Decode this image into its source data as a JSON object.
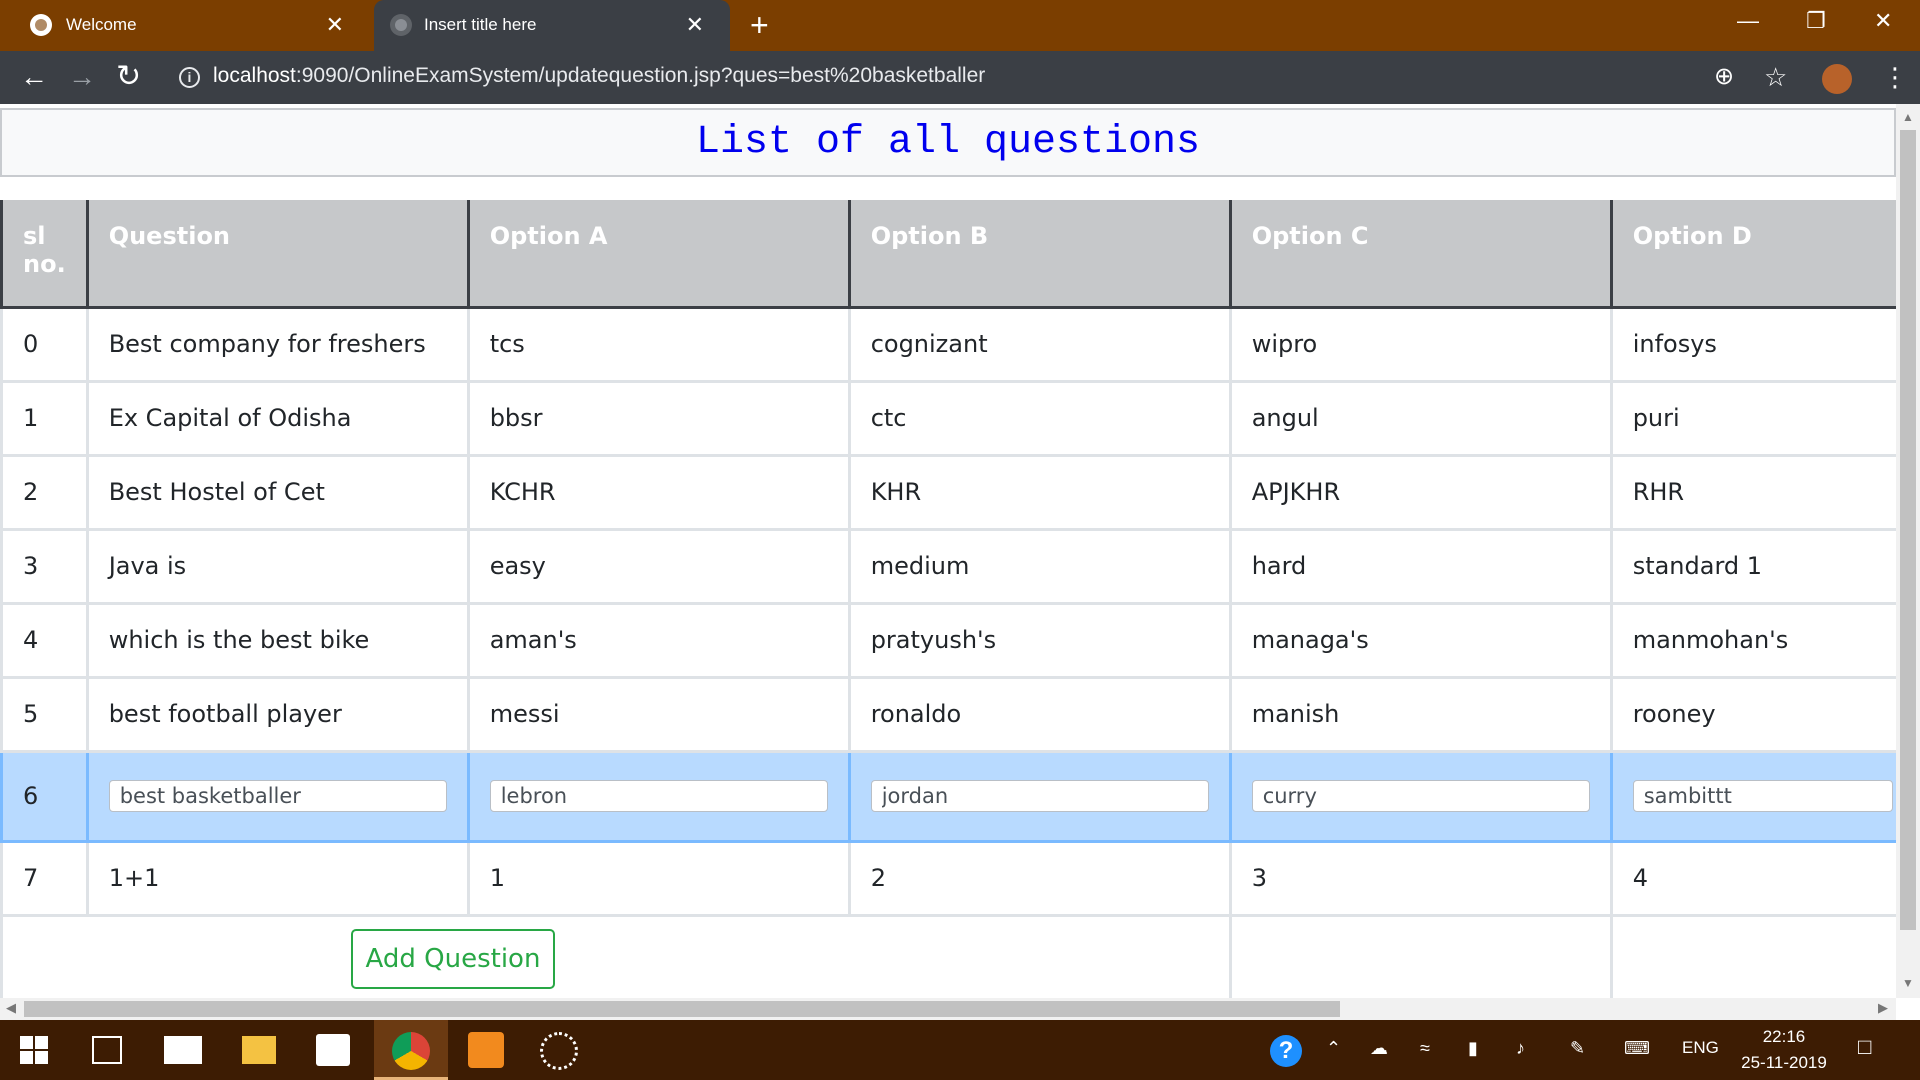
{
  "browser": {
    "tabs": [
      {
        "label": "Welcome",
        "close": "✕"
      },
      {
        "label": "Insert title here",
        "close": "✕"
      }
    ],
    "new_tab": "+",
    "url_host": "localhost",
    "url_rest": ":9090/OnlineExamSystem/updatequestion.jsp?ques=best%20basketballer"
  },
  "page": {
    "heading": "List of all questions",
    "table": {
      "headers": [
        "sl no.",
        "Question",
        "Option A",
        "Option B",
        "Option C",
        "Option D"
      ],
      "rows": [
        [
          "0",
          "Best company for freshers",
          "tcs",
          "cognizant",
          "wipro",
          "infosys"
        ],
        [
          "1",
          "Ex Capital of Odisha",
          "bbsr",
          "ctc",
          "angul",
          "puri"
        ],
        [
          "2",
          "Best Hostel of Cet",
          "KCHR",
          "KHR",
          "APJKHR",
          "RHR"
        ],
        [
          "3",
          "Java is",
          "easy",
          "medium",
          "hard",
          "standard 1"
        ],
        [
          "4",
          "which is the best bike",
          "aman's",
          "pratyush's",
          "managa's",
          "manmohan's"
        ],
        [
          "5",
          "best football player",
          "messi",
          "ronaldo",
          "manish",
          "rooney"
        ]
      ],
      "edit_row": {
        "sl": "6",
        "question": "best basketballer",
        "option_a": "lebron",
        "option_b": "jordan",
        "option_c": "curry",
        "option_d": "sambittt"
      },
      "last_row": [
        "7",
        "1+1",
        "1",
        "2",
        "3",
        "4"
      ]
    },
    "add_button": "Add Question"
  },
  "taskbar": {
    "language": "ENG",
    "time": "22:16",
    "date": "25-11-2019"
  },
  "colors": {
    "titlebar": "#7b3e00",
    "toolbar": "#3b3f45",
    "heading_text": "#0000ee",
    "table_header": "#c6c8ca",
    "edit_row": "#b8daff",
    "add_button": "#28a745",
    "taskbar": "#3d1c03"
  }
}
